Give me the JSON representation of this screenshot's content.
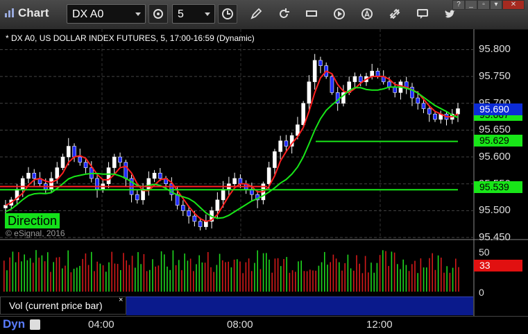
{
  "window": {
    "title": "Chart",
    "symbol": "DX A0",
    "interval": "5"
  },
  "chart": {
    "info_line": "* DX A0, US DOLLAR INDEX FUTURES, 5, 17:00-16:59 (Dynamic)",
    "study_label": "Direction",
    "copyright": "© eSignal, 2016",
    "price_axis": [
      "95.800",
      "95.750",
      "95.700",
      "95.650",
      "95.600",
      "95.550",
      "95.500",
      "95.450"
    ],
    "price_tags": {
      "last": "95.690",
      "hidden": "95.667",
      "upper_line": "95.629",
      "lower_line": "95.539"
    },
    "volume_axis": [
      "50",
      "0"
    ],
    "volume_tag": "33",
    "volume_study": "Vol (current price bar)",
    "time_axis": [
      "04:00",
      "08:00",
      "12:00"
    ],
    "time_mode": "Dyn",
    "colors": {
      "up_candle": "#ffffff",
      "down_candle": "#1f2cff",
      "red_ma": "#ff2020",
      "green_ma": "#18e618",
      "direction_bg": "#14e01a",
      "volume_tag_bg": "#e11010"
    }
  },
  "chart_data": {
    "type": "candlestick",
    "ylim": [
      95.45,
      95.82
    ],
    "horizontal_lines": [
      {
        "name": "upper",
        "value": 95.629,
        "color": "#18e618"
      },
      {
        "name": "lower",
        "value": 95.539,
        "color": "#18e618"
      },
      {
        "name": "red_level",
        "value": 95.545,
        "color": "#ff2020"
      }
    ],
    "price_path": [
      95.51,
      95.52,
      95.54,
      95.56,
      95.57,
      95.56,
      95.55,
      95.54,
      95.56,
      95.58,
      95.6,
      95.62,
      95.6,
      95.59,
      95.58,
      95.56,
      95.54,
      95.55,
      95.58,
      95.6,
      95.59,
      95.56,
      95.53,
      95.52,
      95.54,
      95.56,
      95.57,
      95.56,
      95.55,
      95.53,
      95.51,
      95.5,
      95.49,
      95.48,
      95.47,
      95.48,
      95.5,
      95.52,
      95.54,
      95.55,
      95.56,
      95.55,
      95.54,
      95.53,
      95.52,
      95.55,
      95.58,
      95.61,
      95.63,
      95.62,
      95.64,
      95.66,
      95.7,
      95.74,
      95.78,
      95.77,
      95.75,
      95.72,
      95.7,
      95.72,
      95.74,
      95.75,
      95.74,
      95.75,
      95.76,
      95.75,
      95.74,
      95.73,
      95.72,
      95.74,
      95.73,
      95.71,
      95.7,
      95.69,
      95.68,
      95.67,
      95.68,
      95.67,
      95.68,
      95.69
    ],
    "volume": {
      "ylim": [
        0,
        60
      ],
      "last": 33
    }
  }
}
